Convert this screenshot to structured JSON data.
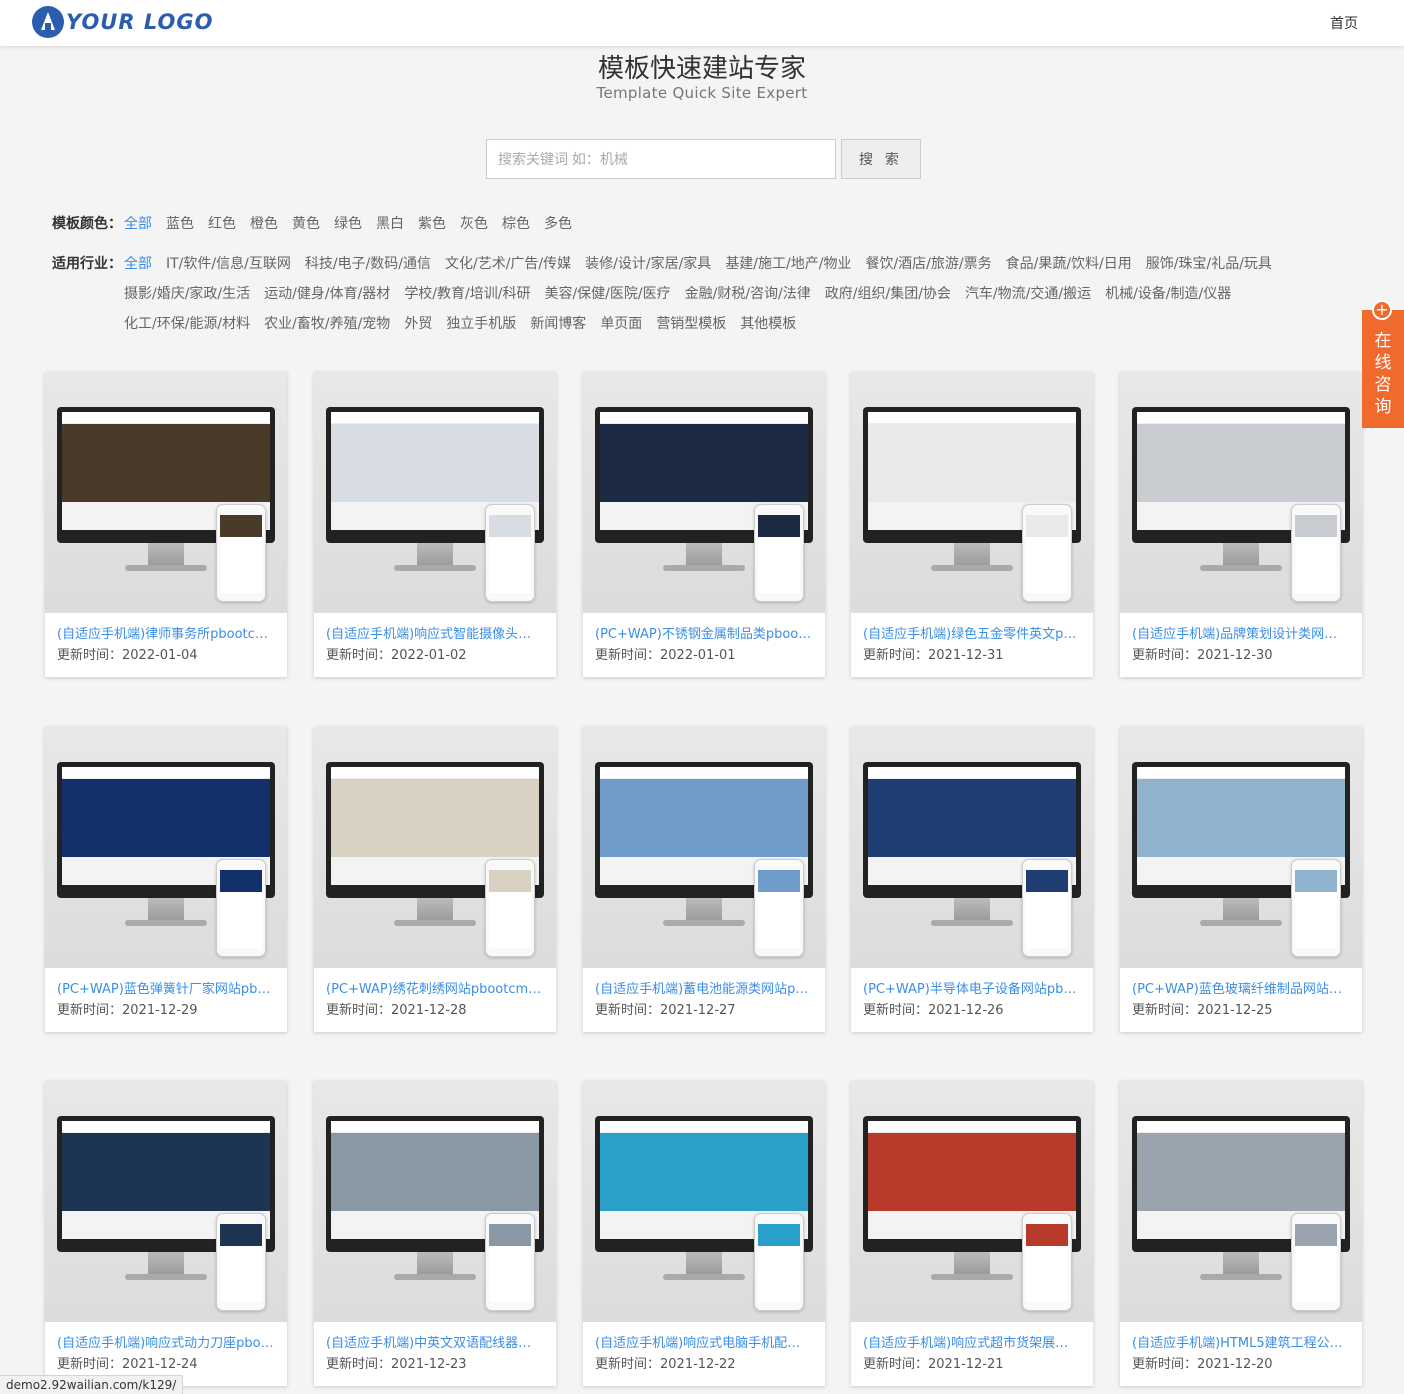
{
  "header": {
    "logo_text": "YOUR LOGO",
    "nav_home": "首页"
  },
  "hero": {
    "title": "模板快速建站专家",
    "subtitle": "Template Quick Site Expert"
  },
  "search": {
    "placeholder": "搜索关键词 如：机械",
    "button": "搜 索"
  },
  "filters": {
    "color_label": "模板颜色：",
    "colors": [
      "全部",
      "蓝色",
      "红色",
      "橙色",
      "黄色",
      "绿色",
      "黑白",
      "紫色",
      "灰色",
      "棕色",
      "多色"
    ],
    "industry_label": "适用行业：",
    "industries": [
      "全部",
      "IT/软件/信息/互联网",
      "科技/电子/数码/通信",
      "文化/艺术/广告/传媒",
      "装修/设计/家居/家具",
      "基建/施工/地产/物业",
      "餐饮/酒店/旅游/票务",
      "食品/果蔬/饮料/日用",
      "服饰/珠宝/礼品/玩具",
      "摄影/婚庆/家政/生活",
      "运动/健身/体育/器材",
      "学校/教育/培训/科研",
      "美容/保健/医院/医疗",
      "金融/财税/咨询/法律",
      "政府/组织/集团/协会",
      "汽车/物流/交通/搬运",
      "机械/设备/制造/仪器",
      "化工/环保/能源/材料",
      "农业/畜牧/养殖/宠物",
      "外贸",
      "独立手机版",
      "新闻博客",
      "单页面",
      "营销型模板",
      "其他模板"
    ]
  },
  "templates": [
    {
      "title": "(自适应手机端)律师事务所pbootcms...",
      "date_label": "更新时间：",
      "date": "2022-01-04",
      "theme": "#4a3a2a"
    },
    {
      "title": "(自适应手机端)响应式智能摄像头设备p...",
      "date_label": "更新时间：",
      "date": "2022-01-02",
      "theme": "#d8dde3"
    },
    {
      "title": "(PC+WAP)不锈钢金属制品类pbootc...",
      "date_label": "更新时间：",
      "date": "2022-01-01",
      "theme": "#1c2a44"
    },
    {
      "title": "(自适应手机端)绿色五金零件英文pboo...",
      "date_label": "更新时间：",
      "date": "2021-12-31",
      "theme": "#e9e9e9"
    },
    {
      "title": "(自适应手机端)品牌策划设计类网站pb...",
      "date_label": "更新时间：",
      "date": "2021-12-30",
      "theme": "#c9ccd0"
    },
    {
      "title": "(PC+WAP)蓝色弹簧针厂家网站pboot...",
      "date_label": "更新时间：",
      "date": "2021-12-29",
      "theme": "#13306a"
    },
    {
      "title": "(PC+WAP)绣花刺绣网站pbootcms模...",
      "date_label": "更新时间：",
      "date": "2021-12-28",
      "theme": "#d9d2c2"
    },
    {
      "title": "(自适应手机端)蓄电池能源类网站pboo...",
      "date_label": "更新时间：",
      "date": "2021-12-27",
      "theme": "#6f9cc9"
    },
    {
      "title": "(PC+WAP)半导体电子设备网站pboot...",
      "date_label": "更新时间：",
      "date": "2021-12-26",
      "theme": "#1f3d73"
    },
    {
      "title": "(PC+WAP)蓝色玻璃纤维制品网站pbo...",
      "date_label": "更新时间：",
      "date": "2021-12-25",
      "theme": "#8fb3cc"
    },
    {
      "title": "(自适应手机端)响应式动力刀座pbootc...",
      "date_label": "更新时间：",
      "date": "2021-12-24",
      "theme": "#1d3452"
    },
    {
      "title": "(自适应手机端)中英文双语配线器材类...",
      "date_label": "更新时间：",
      "date": "2021-12-23",
      "theme": "#8a98a6"
    },
    {
      "title": "(自适应手机端)响应式电脑手机配件网...",
      "date_label": "更新时间：",
      "date": "2021-12-22",
      "theme": "#2a9fc9"
    },
    {
      "title": "(自适应手机端)响应式超市货架展架类...",
      "date_label": "更新时间：",
      "date": "2021-12-21",
      "theme": "#b83a2a"
    },
    {
      "title": "(自适应手机端)HTML5建筑工程公司网...",
      "date_label": "更新时间：",
      "date": "2021-12-20",
      "theme": "#9aa4ae"
    }
  ],
  "side": {
    "consult": "在线咨询",
    "plus_icon": "+"
  },
  "status_bar": {
    "url": "demo2.92wailian.com/k129/"
  }
}
